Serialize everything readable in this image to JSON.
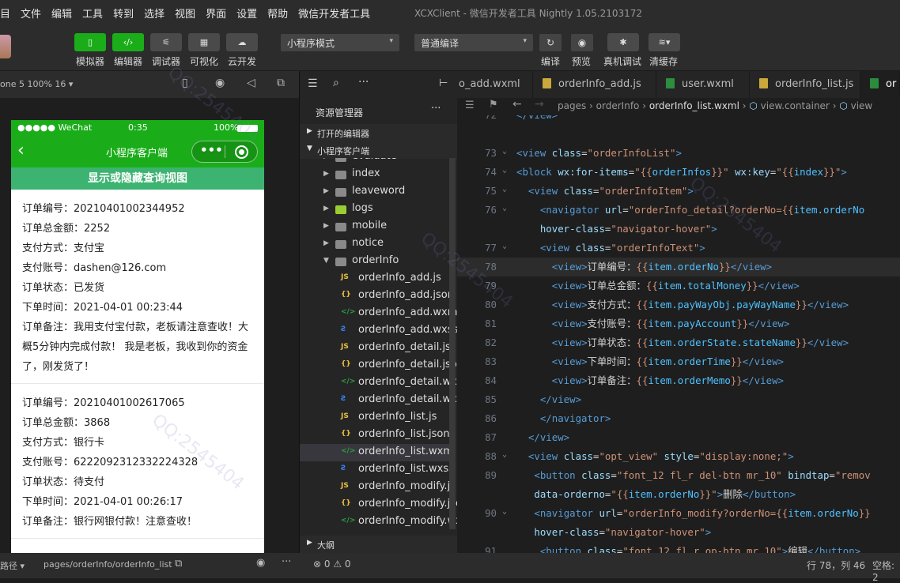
{
  "menu": {
    "items": [
      "目",
      "文件",
      "编辑",
      "工具",
      "转到",
      "选择",
      "视图",
      "界面",
      "设置",
      "帮助",
      "微信开发者工具"
    ],
    "window_title": "XCXClient - 微信开发者工具 Nightly 1.05.2103172"
  },
  "toolbar": {
    "simulator": "模拟器",
    "editor": "编辑器",
    "debugger": "调试器",
    "visual": "可视化",
    "cloud": "云开发",
    "mode_select": "小程序模式",
    "compile_select": "普通编译",
    "compile": "编译",
    "preview": "预览",
    "real_debug": "真机调试",
    "clear_cache": "清缓存"
  },
  "simulator": {
    "device": "one 5 100% 16 ▾",
    "status": {
      "carrier": "●●●●● WeChat",
      "time": "0:35",
      "battery": "100%"
    },
    "nav_title": "小程序客户端",
    "banner": "显示或隐藏查询视图",
    "orders": [
      {
        "lines": [
          "订单编号：20210401002344952",
          "订单总金额：2252",
          "支付方式：支付宝",
          "支付账号：dashen@126.com",
          "订单状态：已发货",
          "下单时间：2021-04-01 00:23:44",
          "订单备注：我用支付宝付款，老板请注意查收！大",
          "概5分钟内完成付款！ 我是老板，我收到你的资金",
          "了，刚发货了！"
        ]
      },
      {
        "lines": [
          "订单编号：20210401002617065",
          "订单总金额：3868",
          "支付方式：银行卡",
          "支付账号：6222092312332224328",
          "订单状态：待支付",
          "下单时间：2021-04-01 00:26:17",
          "订单备注：银行网银付款！注意查收！"
        ]
      }
    ],
    "footer_path_label": "路径 ▾",
    "footer_path": "pages/orderInfo/orderInfo_list"
  },
  "explorer": {
    "title": "资源管理器",
    "open_editors": "打开的编辑器",
    "project": "小程序客户端",
    "outline": "大纲",
    "tree": [
      {
        "label": "evaluate",
        "type": "folder"
      },
      {
        "label": "index",
        "type": "folder"
      },
      {
        "label": "leaveword",
        "type": "folder"
      },
      {
        "label": "logs",
        "type": "folder-green"
      },
      {
        "label": "mobile",
        "type": "folder"
      },
      {
        "label": "notice",
        "type": "folder"
      },
      {
        "label": "orderInfo",
        "type": "folder-open"
      },
      {
        "label": "orderInfo_add.js",
        "type": "js"
      },
      {
        "label": "orderInfo_add.json",
        "type": "json"
      },
      {
        "label": "orderInfo_add.wxml",
        "type": "wxml"
      },
      {
        "label": "orderInfo_add.wxss",
        "type": "wxss"
      },
      {
        "label": "orderInfo_detail.js",
        "type": "js"
      },
      {
        "label": "orderInfo_detail.json",
        "type": "json"
      },
      {
        "label": "orderInfo_detail.wxml",
        "type": "wxml"
      },
      {
        "label": "orderInfo_detail.wxss",
        "type": "wxss"
      },
      {
        "label": "orderInfo_list.js",
        "type": "js"
      },
      {
        "label": "orderInfo_list.json",
        "type": "json"
      },
      {
        "label": "orderInfo_list.wxml",
        "type": "wxml",
        "selected": true
      },
      {
        "label": "orderInfo_list.wxss",
        "type": "wxss"
      },
      {
        "label": "orderInfo_modify.js",
        "type": "js"
      },
      {
        "label": "orderInfo_modify.json",
        "type": "json"
      },
      {
        "label": "orderInfo_modify.wx...",
        "type": "wxml"
      }
    ],
    "footer": "⊗ 0 ⚠ 0"
  },
  "editor": {
    "tabs": [
      {
        "label": "o_add.wxml",
        "type": "none"
      },
      {
        "label": "orderInfo_add.js",
        "type": "js"
      },
      {
        "label": "user.wxml",
        "type": "wxml"
      },
      {
        "label": "orderInfo_list.js",
        "type": "js"
      },
      {
        "label": "or",
        "type": "wxml",
        "active": true
      }
    ],
    "breadcrumb": [
      "pages",
      "orderInfo",
      "orderInfo_list.wxml",
      "view.container",
      "view"
    ],
    "lines": [
      {
        "n": "72",
        "fold": "",
        "hl": false,
        "segs": [
          [
            "tg",
            "</view>"
          ]
        ]
      },
      {
        "n": "",
        "fold": "",
        "hl": false,
        "segs": []
      },
      {
        "n": "73",
        "fold": "⌄",
        "hl": false,
        "segs": [
          [
            "tg",
            "<view "
          ],
          [
            "at",
            "class"
          ],
          [
            "tx",
            "="
          ],
          [
            "st",
            "\"orderInfoList\""
          ],
          [
            "tg",
            ">"
          ]
        ]
      },
      {
        "n": "74",
        "fold": "⌄",
        "hl": false,
        "segs": [
          [
            "tg",
            "<block "
          ],
          [
            "at",
            "wx:for-items"
          ],
          [
            "tx",
            "="
          ],
          [
            "st",
            "\"{{"
          ],
          [
            "ex",
            "orderInfos"
          ],
          [
            "st",
            "}}\""
          ],
          [
            "tx",
            " "
          ],
          [
            "at",
            "wx:key"
          ],
          [
            "tx",
            "="
          ],
          [
            "st",
            "\"{{"
          ],
          [
            "ex",
            "index"
          ],
          [
            "st",
            "}}\""
          ],
          [
            "tg",
            ">"
          ]
        ]
      },
      {
        "n": "75",
        "fold": "⌄",
        "hl": false,
        "segs": [
          [
            "tx",
            "  "
          ],
          [
            "tg",
            "<view "
          ],
          [
            "at",
            "class"
          ],
          [
            "tx",
            "="
          ],
          [
            "st",
            "\"orderInfoItem\""
          ],
          [
            "tg",
            ">"
          ]
        ]
      },
      {
        "n": "76",
        "fold": "⌄",
        "hl": false,
        "segs": [
          [
            "tx",
            "    "
          ],
          [
            "tg",
            "<navigator "
          ],
          [
            "at",
            "url"
          ],
          [
            "tx",
            "="
          ],
          [
            "st",
            "\"orderInfo_detail?orderNo={{"
          ],
          [
            "ex",
            "item.orderNo"
          ]
        ]
      },
      {
        "n": "",
        "fold": "",
        "hl": false,
        "segs": [
          [
            "tx",
            "    "
          ],
          [
            "at",
            "hover-class"
          ],
          [
            "tx",
            "="
          ],
          [
            "st",
            "\"navigator-hover\""
          ],
          [
            "tg",
            ">"
          ]
        ]
      },
      {
        "n": "77",
        "fold": "⌄",
        "hl": false,
        "segs": [
          [
            "tx",
            "    "
          ],
          [
            "tg",
            "<view "
          ],
          [
            "at",
            "class"
          ],
          [
            "tx",
            "="
          ],
          [
            "st",
            "\"orderInfoText\""
          ],
          [
            "tg",
            ">"
          ]
        ]
      },
      {
        "n": "78",
        "fold": "",
        "hl": true,
        "segs": [
          [
            "tx",
            "      "
          ],
          [
            "tg",
            "<view>"
          ],
          [
            "tx",
            "订单编号："
          ],
          [
            "st",
            "{{"
          ],
          [
            "ex",
            "item.orderNo"
          ],
          [
            "st",
            "}}"
          ],
          [
            "tg",
            "</view>"
          ]
        ]
      },
      {
        "n": "79",
        "fold": "",
        "hl": false,
        "segs": [
          [
            "tx",
            "      "
          ],
          [
            "tg",
            "<view>"
          ],
          [
            "tx",
            "订单总金额："
          ],
          [
            "st",
            "{{"
          ],
          [
            "ex",
            "item.totalMoney"
          ],
          [
            "st",
            "}}"
          ],
          [
            "tg",
            "</view>"
          ]
        ]
      },
      {
        "n": "80",
        "fold": "",
        "hl": false,
        "segs": [
          [
            "tx",
            "      "
          ],
          [
            "tg",
            "<view>"
          ],
          [
            "tx",
            "支付方式："
          ],
          [
            "st",
            "{{"
          ],
          [
            "ex",
            "item.payWayObj.payWayName"
          ],
          [
            "st",
            "}}"
          ],
          [
            "tg",
            "</view>"
          ]
        ]
      },
      {
        "n": "81",
        "fold": "",
        "hl": false,
        "segs": [
          [
            "tx",
            "      "
          ],
          [
            "tg",
            "<view>"
          ],
          [
            "tx",
            "支付账号："
          ],
          [
            "st",
            "{{"
          ],
          [
            "ex",
            "item.payAccount"
          ],
          [
            "st",
            "}}"
          ],
          [
            "tg",
            "</view>"
          ]
        ]
      },
      {
        "n": "82",
        "fold": "",
        "hl": false,
        "segs": [
          [
            "tx",
            "      "
          ],
          [
            "tg",
            "<view>"
          ],
          [
            "tx",
            "订单状态："
          ],
          [
            "st",
            "{{"
          ],
          [
            "ex",
            "item.orderState.stateName"
          ],
          [
            "st",
            "}}"
          ],
          [
            "tg",
            "</view>"
          ]
        ]
      },
      {
        "n": "83",
        "fold": "",
        "hl": false,
        "segs": [
          [
            "tx",
            "      "
          ],
          [
            "tg",
            "<view>"
          ],
          [
            "tx",
            "下单时间："
          ],
          [
            "st",
            "{{"
          ],
          [
            "ex",
            "item.orderTime"
          ],
          [
            "st",
            "}}"
          ],
          [
            "tg",
            "</view>"
          ]
        ]
      },
      {
        "n": "84",
        "fold": "",
        "hl": false,
        "segs": [
          [
            "tx",
            "      "
          ],
          [
            "tg",
            "<view>"
          ],
          [
            "tx",
            "订单备注："
          ],
          [
            "st",
            "{{"
          ],
          [
            "ex",
            "item.orderMemo"
          ],
          [
            "st",
            "}}"
          ],
          [
            "tg",
            "</view>"
          ]
        ]
      },
      {
        "n": "85",
        "fold": "",
        "hl": false,
        "segs": [
          [
            "tx",
            "    "
          ],
          [
            "tg",
            "</view>"
          ]
        ]
      },
      {
        "n": "86",
        "fold": "",
        "hl": false,
        "segs": [
          [
            "tx",
            "    "
          ],
          [
            "tg",
            "</navigator>"
          ]
        ]
      },
      {
        "n": "87",
        "fold": "",
        "hl": false,
        "segs": [
          [
            "tx",
            "  "
          ],
          [
            "tg",
            "</view>"
          ]
        ]
      },
      {
        "n": "88",
        "fold": "⌄",
        "hl": false,
        "segs": [
          [
            "tx",
            "  "
          ],
          [
            "tg",
            "<view "
          ],
          [
            "at",
            "class"
          ],
          [
            "tx",
            "="
          ],
          [
            "st",
            "\"opt_view\""
          ],
          [
            "tx",
            " "
          ],
          [
            "at",
            "style"
          ],
          [
            "tx",
            "="
          ],
          [
            "st",
            "\"display:none;\""
          ],
          [
            "tg",
            ">"
          ]
        ]
      },
      {
        "n": "89",
        "fold": "",
        "hl": false,
        "segs": [
          [
            "tx",
            "   "
          ],
          [
            "tg",
            "<button "
          ],
          [
            "at",
            "class"
          ],
          [
            "tx",
            "="
          ],
          [
            "st",
            "\"font_12 fl_r del-btn mr_10\""
          ],
          [
            "tx",
            " "
          ],
          [
            "at",
            "bindtap"
          ],
          [
            "tx",
            "="
          ],
          [
            "st",
            "\"remov"
          ]
        ]
      },
      {
        "n": "",
        "fold": "",
        "hl": false,
        "segs": [
          [
            "tx",
            "   "
          ],
          [
            "at",
            "data-orderno"
          ],
          [
            "tx",
            "="
          ],
          [
            "st",
            "\"{{"
          ],
          [
            "ex",
            "item.orderNo"
          ],
          [
            "st",
            "}}\""
          ],
          [
            "tg",
            ">"
          ],
          [
            "tx",
            "删除"
          ],
          [
            "tg",
            "</button>"
          ]
        ]
      },
      {
        "n": "90",
        "fold": "⌄",
        "hl": false,
        "segs": [
          [
            "tx",
            "   "
          ],
          [
            "tg",
            "<navigator "
          ],
          [
            "at",
            "url"
          ],
          [
            "tx",
            "="
          ],
          [
            "st",
            "\"orderInfo_modify?orderNo={{"
          ],
          [
            "ex",
            "item.orderNo"
          ],
          [
            "st",
            "}}"
          ]
        ]
      },
      {
        "n": "",
        "fold": "",
        "hl": false,
        "segs": [
          [
            "tx",
            "   "
          ],
          [
            "at",
            "hover-class"
          ],
          [
            "tx",
            "="
          ],
          [
            "st",
            "\"navigator-hover\""
          ],
          [
            "tg",
            ">"
          ]
        ]
      },
      {
        "n": "91",
        "fold": "",
        "hl": false,
        "segs": [
          [
            "tx",
            "    "
          ],
          [
            "tg",
            "<button "
          ],
          [
            "at",
            "class"
          ],
          [
            "tx",
            "="
          ],
          [
            "st",
            "\"font_12 fl_r op-btn mr_10\""
          ],
          [
            "tg",
            ">"
          ],
          [
            "tx",
            "编辑"
          ],
          [
            "tg",
            "</button>"
          ]
        ]
      }
    ],
    "status": {
      "position": "行 78，列 46",
      "spaces": "空格: 2"
    }
  }
}
